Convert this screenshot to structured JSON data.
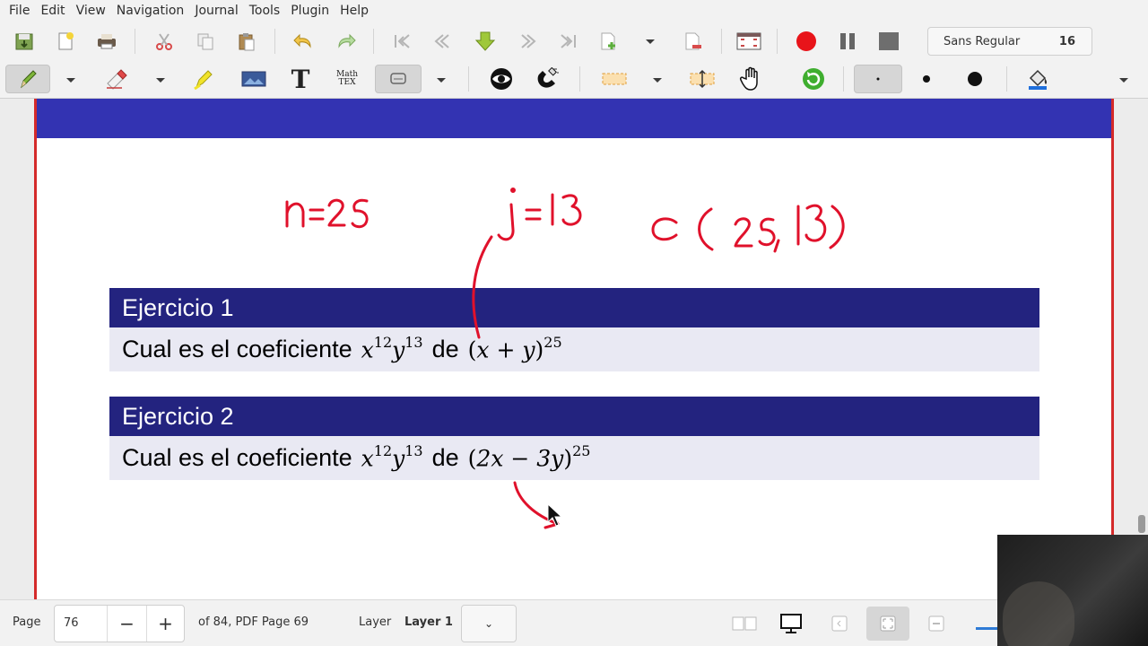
{
  "menu": [
    "File",
    "Edit",
    "View",
    "Navigation",
    "Journal",
    "Tools",
    "Plugin",
    "Help"
  ],
  "toolbar": {
    "font_name": "Sans Regular",
    "font_size": "16",
    "math_tex_top": "Math",
    "math_tex_bottom": "TEX",
    "text_tool_glyph": "T"
  },
  "colors": {
    "accent_blue": "#3333b2",
    "block_title": "#23237f",
    "block_body": "#e9e9f3",
    "ink_red": "#e0112b",
    "record_red": "#e8141a"
  },
  "document": {
    "blocks": [
      {
        "title": "Ejercicio 1",
        "body_text": "Cual es el coeficiente",
        "term_a": "x",
        "exp_a": "12",
        "term_b": "y",
        "exp_b": "13",
        "word_de": "de",
        "binomial_open": "(",
        "binomial_1": "x",
        "binomial_op": " + ",
        "binomial_2": "y",
        "binomial_close": ")",
        "binomial_exp": "25"
      },
      {
        "title": "Ejercicio 2",
        "body_text": "Cual es el coeficiente",
        "term_a": "x",
        "exp_a": "12",
        "term_b": "y",
        "exp_b": "13",
        "word_de": "de",
        "binomial_open": "(",
        "binomial_1": "2x",
        "binomial_op": " − ",
        "binomial_2": "3y",
        "binomial_close": ")",
        "binomial_exp": "25"
      }
    ]
  },
  "status": {
    "page_label": "Page",
    "page_value": "76",
    "minus": "−",
    "plus": "+",
    "of_label": "of 84, PDF Page 69",
    "layer_label": "Layer",
    "layer_value": "Layer 1",
    "layer_caret": "⌄"
  }
}
